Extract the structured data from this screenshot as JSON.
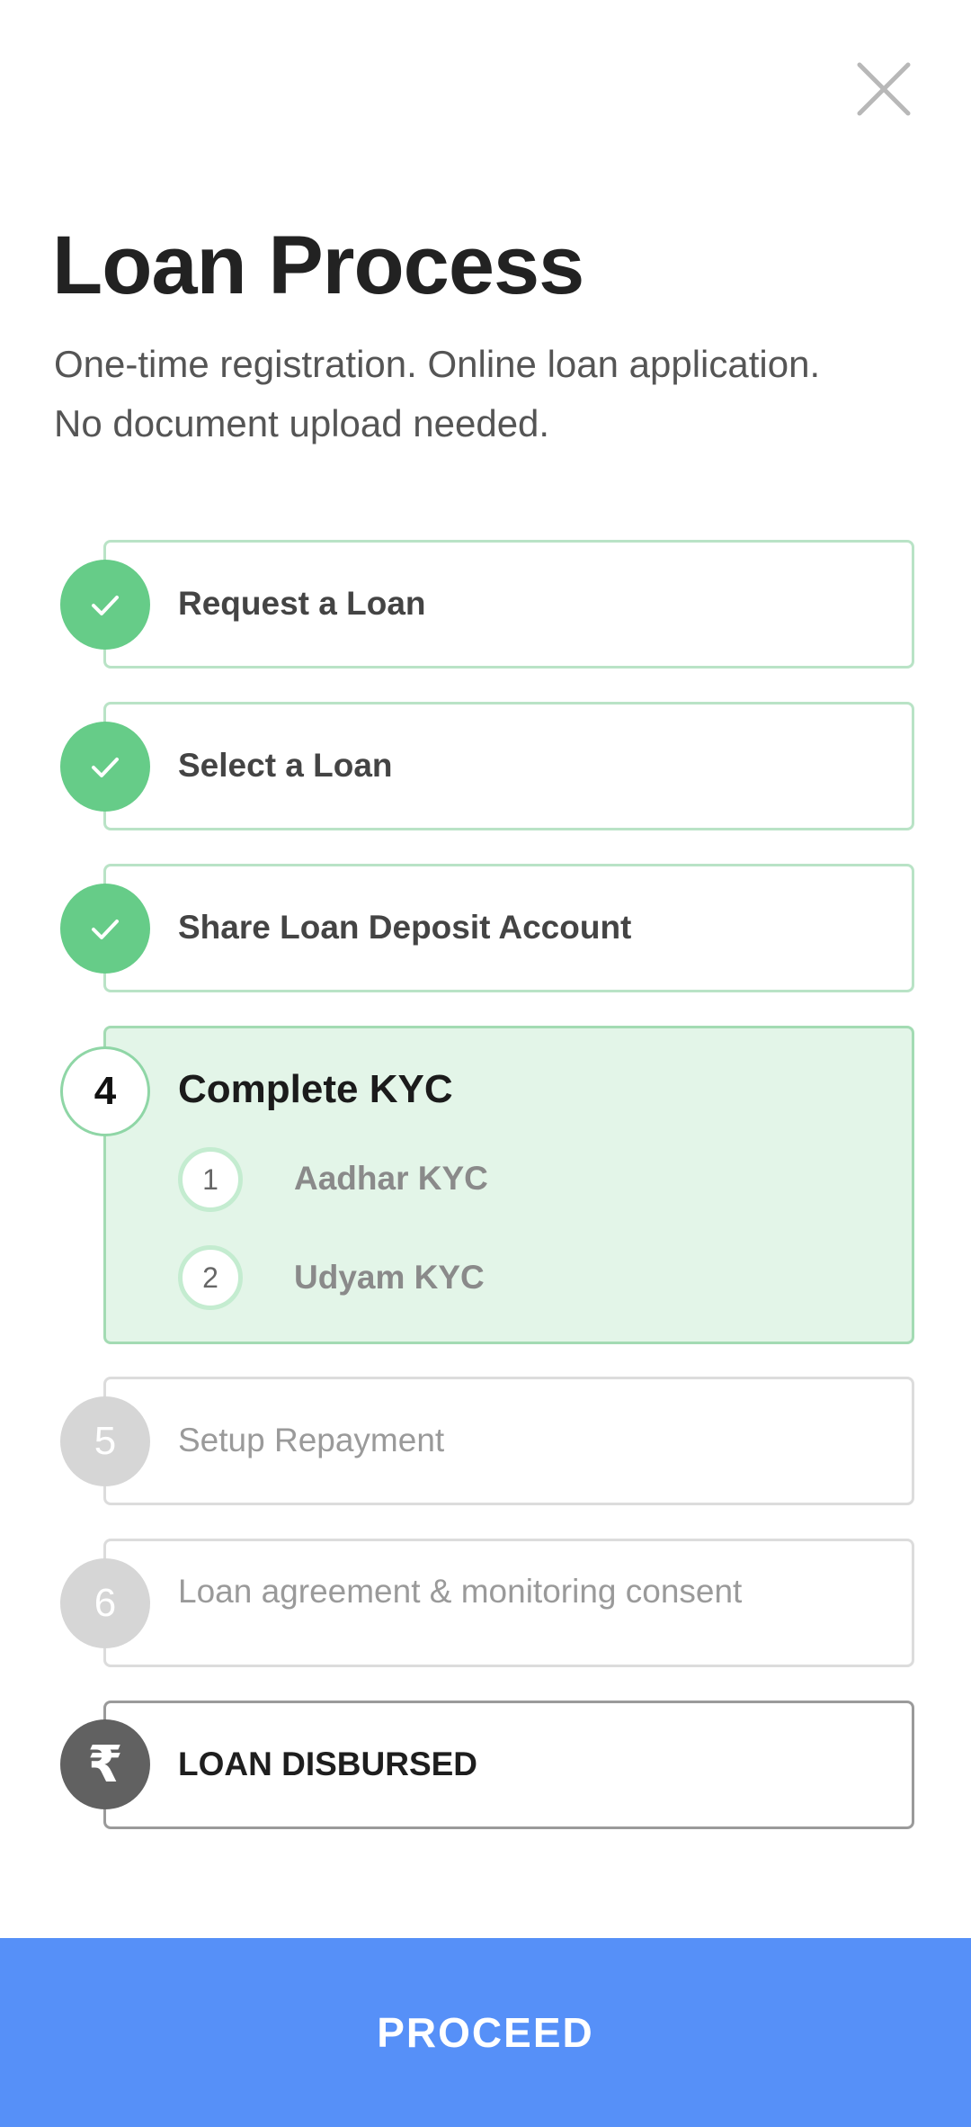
{
  "header": {
    "title": "Loan Process",
    "subtitle_line1": "One-time registration. Online loan application.",
    "subtitle_line2": "No document upload needed."
  },
  "steps": [
    {
      "label": "Request a Loan",
      "status": "done"
    },
    {
      "label": "Select a Loan",
      "status": "done"
    },
    {
      "label": "Share Loan Deposit Account",
      "status": "done"
    },
    {
      "number": "4",
      "label": "Complete KYC",
      "status": "active",
      "substeps": [
        {
          "number": "1",
          "label": "Aadhar KYC"
        },
        {
          "number": "2",
          "label": "Udyam KYC"
        }
      ]
    },
    {
      "number": "5",
      "label": "Setup Repayment",
      "status": "pending"
    },
    {
      "number": "6",
      "label": "Loan agreement & monitoring consent",
      "status": "pending"
    },
    {
      "symbol": "₹",
      "label": "LOAN DISBURSED",
      "status": "final"
    }
  ],
  "footer": {
    "proceed_label": "PROCEED"
  },
  "colors": {
    "done_green": "#66cc88",
    "active_bg": "#e3f5e8",
    "primary_blue": "#5690f8",
    "pending_grey": "#d6d6d6",
    "final_grey": "#616161"
  }
}
